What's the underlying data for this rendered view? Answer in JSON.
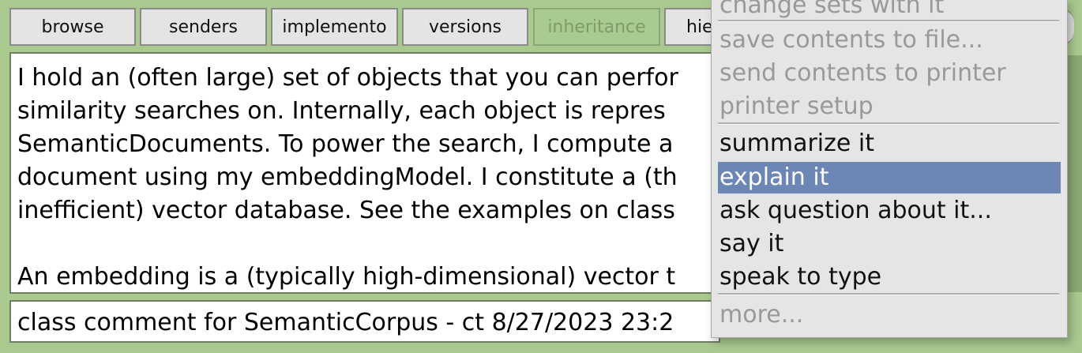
{
  "toolbar": {
    "buttons": [
      {
        "label": "browse",
        "active": false
      },
      {
        "label": "senders",
        "active": false
      },
      {
        "label": "implemento",
        "active": false
      },
      {
        "label": "versions",
        "active": false
      },
      {
        "label": "inheritance",
        "active": true
      },
      {
        "label": "hie",
        "active": false
      }
    ]
  },
  "comment": {
    "lines": [
      "I hold an (often large) set of objects that you can perfor",
      "similarity searches on. Internally, each object is repres",
      "SemanticDocuments. To power the search, I compute a",
      "document using my embeddingModel. I constitute a (th",
      "inefficient) vector database. See the examples on class",
      "",
      "An embedding is a (typically high-dimensional) vector t"
    ]
  },
  "status": {
    "text": "class comment for SemanticCorpus - ct 8/27/2023 23:2"
  },
  "menu": {
    "items": [
      {
        "label": "change sets with it",
        "disabled": true
      },
      {
        "label": "save contents to file...",
        "disabled": true
      },
      {
        "label": "send contents to printer",
        "disabled": true
      },
      {
        "label": "printer setup",
        "disabled": true
      },
      {
        "label": "summarize it",
        "disabled": false
      },
      {
        "label": "explain it",
        "disabled": false,
        "selected": true
      },
      {
        "label": "ask question about it...",
        "disabled": false
      },
      {
        "label": "say it",
        "disabled": false
      },
      {
        "label": "speak to type",
        "disabled": false
      },
      {
        "label": "more...",
        "disabled": true
      }
    ]
  },
  "colors": {
    "window_bg": "#a9c98f",
    "active_button": "#aacb8f",
    "menu_bg": "#e5e5e5",
    "menu_selection": "#6c86b6"
  }
}
